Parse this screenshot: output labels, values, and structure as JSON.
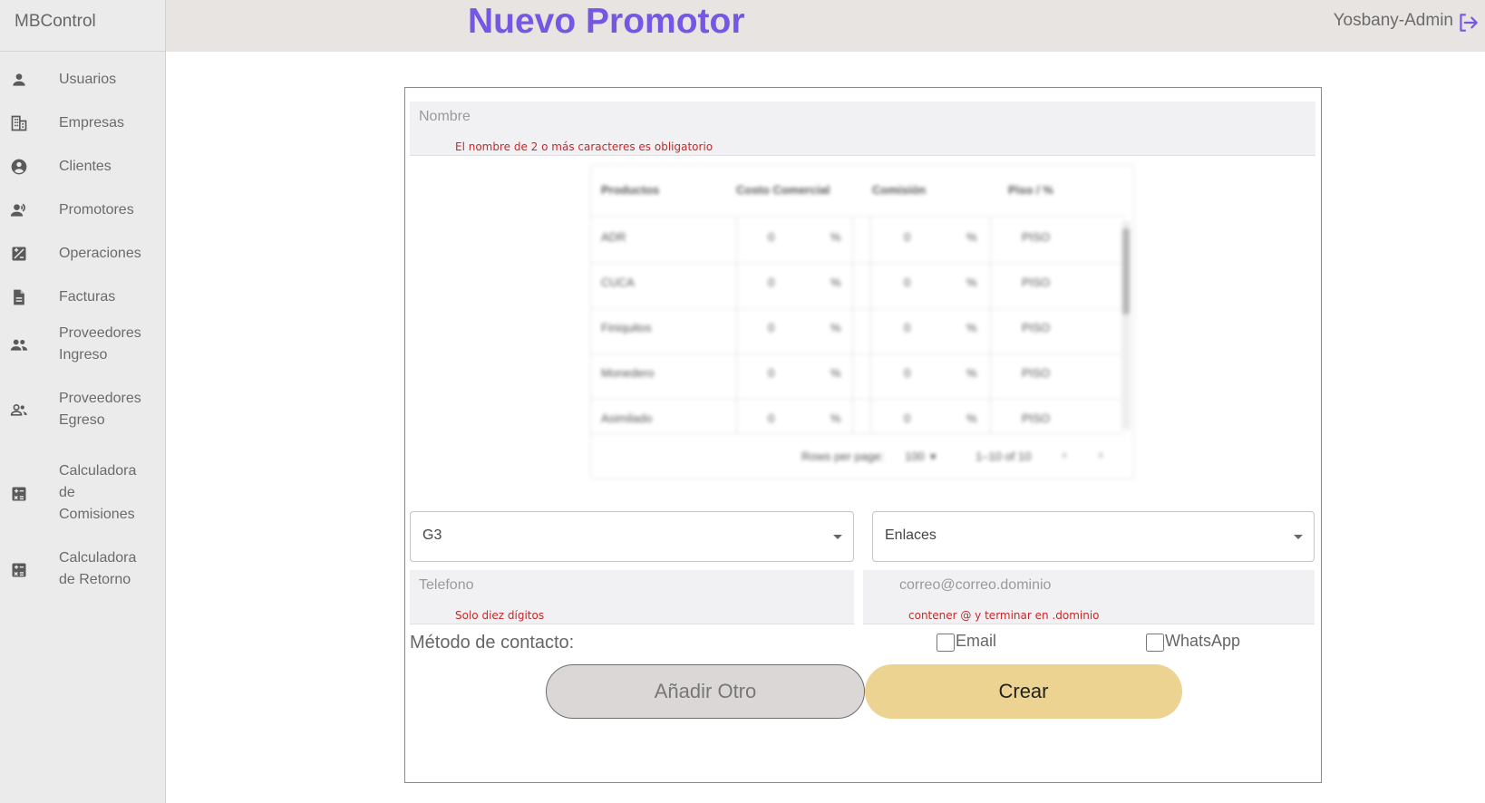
{
  "app": {
    "brand": "MBControl",
    "title": "Nuevo Promotor",
    "user": "Yosbany-Admin"
  },
  "sidebar": {
    "items": [
      {
        "label": "Usuarios",
        "icon": "person-icon"
      },
      {
        "label": "Empresas",
        "icon": "building-icon"
      },
      {
        "label": "Clientes",
        "icon": "account-circle-icon"
      },
      {
        "label": "Promotores",
        "icon": "record-voice-icon"
      },
      {
        "label": "Operaciones",
        "icon": "calculate-box-icon"
      },
      {
        "label": "Facturas",
        "icon": "document-icon"
      },
      {
        "label": "Proveedores\nIngreso",
        "icon": "people-icon"
      },
      {
        "label": "Proveedores\nEgreso",
        "icon": "people-outline-icon"
      },
      {
        "label": "Calculadora\nde\nComisiones",
        "icon": "calculator-icon"
      },
      {
        "label": "Calculadora\nde Retorno",
        "icon": "calculator-icon"
      }
    ]
  },
  "form": {
    "name": {
      "placeholder": "Nombre",
      "error": "El nombre de 2 o más caracteres es obligatorio"
    },
    "grid": {
      "columns": [
        "Productos",
        "Costo Comercial",
        "Comisión",
        "Piso / %"
      ],
      "rows": [
        {
          "product": "ADR",
          "cost": "0",
          "cost_unit": "%",
          "commission": "0",
          "commission_unit": "%",
          "floor": "PISO"
        },
        {
          "product": "CUCA",
          "cost": "0",
          "cost_unit": "%",
          "commission": "0",
          "commission_unit": "%",
          "floor": "PISO"
        },
        {
          "product": "Finiquitos",
          "cost": "0",
          "cost_unit": "%",
          "commission": "0",
          "commission_unit": "%",
          "floor": "PISO"
        },
        {
          "product": "Monedero",
          "cost": "0",
          "cost_unit": "%",
          "commission": "0",
          "commission_unit": "%",
          "floor": "PISO"
        },
        {
          "product": "Asimilado",
          "cost": "0",
          "cost_unit": "%",
          "commission": "0",
          "commission_unit": "%",
          "floor": "PISO"
        }
      ],
      "footer": {
        "rows_per_page_label": "Rows per page:",
        "rows_per_page": "100",
        "range": "1–10 of 10"
      }
    },
    "group_select": "G3",
    "type_select": "Enlaces",
    "phone": {
      "placeholder": "Telefono",
      "error": "Solo diez dígitos"
    },
    "email": {
      "placeholder": "correo@correo.dominio",
      "error": "contener @ y terminar en .dominio"
    },
    "contact": {
      "label": "Método de contacto:",
      "email_label": "Email",
      "whatsapp_label": "WhatsApp"
    },
    "buttons": {
      "add_other": "Añadir Otro",
      "create": "Crear"
    }
  },
  "colors": {
    "title": "#7657e3",
    "primary_button": "#ecd391",
    "secondary_button": "#dcd7d7",
    "error": "#c62828"
  }
}
